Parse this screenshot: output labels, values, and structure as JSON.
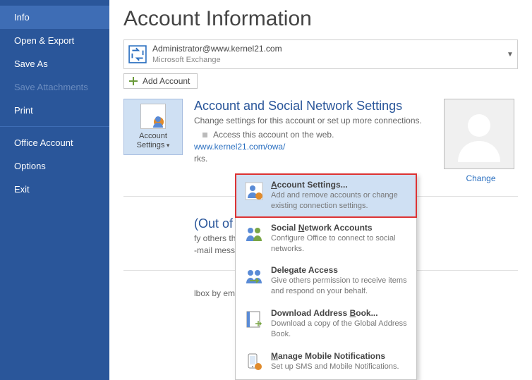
{
  "sidebar": {
    "items": [
      {
        "label": "Info",
        "active": true
      },
      {
        "label": "Open & Export"
      },
      {
        "label": "Save As"
      },
      {
        "label": "Save Attachments",
        "disabled": true
      },
      {
        "label": "Print"
      }
    ],
    "items2": [
      {
        "label": "Office Account"
      },
      {
        "label": "Options"
      },
      {
        "label": "Exit"
      }
    ]
  },
  "page_title": "Account Information",
  "account": {
    "email": "Administrator@www.kernel21.com",
    "type": "Microsoft Exchange"
  },
  "add_account_label": "Add Account",
  "settings_button": {
    "line1": "Account",
    "line2": "Settings"
  },
  "section1": {
    "heading": "Account and Social Network Settings",
    "desc": "Change settings for this account or set up more connections.",
    "bullet": "Access this account on the web.",
    "link_fragment": "www.kernel21.com/owa/",
    "tail": "rks."
  },
  "avatar_change": "Change",
  "dropdown": [
    {
      "title": "Account Settings...",
      "accel": "A",
      "desc": "Add and remove accounts or change existing connection settings.",
      "highlight": true,
      "icon": "account-icon"
    },
    {
      "title": "Social Network Accounts",
      "accel": "N",
      "desc": "Configure Office to connect to social networks.",
      "icon": "social-icon"
    },
    {
      "title": "Delegate Access",
      "accel": "",
      "desc": "Give others permission to receive items and respond on your behalf.",
      "icon": "delegate-icon"
    },
    {
      "title": "Download Address Book...",
      "accel": "B",
      "desc": "Download a copy of the Global Address Book.",
      "icon": "addressbook-icon"
    },
    {
      "title": "Manage Mobile Notifications",
      "accel": "M",
      "desc": "Set up SMS and Mobile Notifications.",
      "icon": "mobile-icon"
    }
  ],
  "section2": {
    "heading_fragment": "(Out of Office)",
    "line1": "fy others that you are out of office, on vacation, or",
    "line2": "-mail messages."
  },
  "section3": {
    "line": "lbox by emptying Deleted Items and archiving."
  }
}
